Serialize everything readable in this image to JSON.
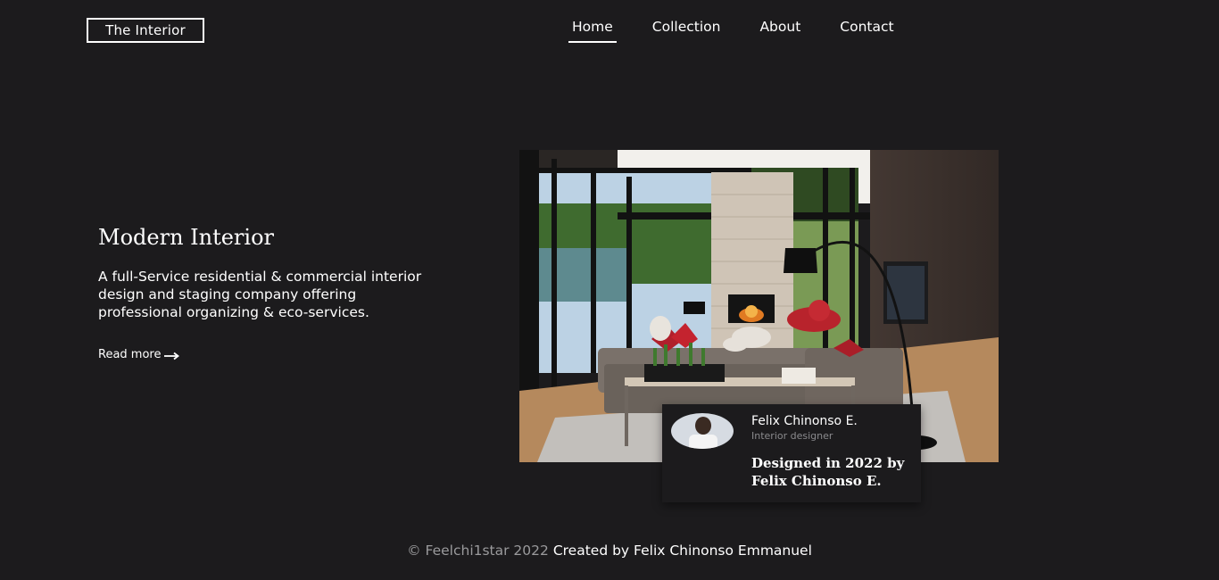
{
  "header": {
    "logo_text": "The Interior",
    "nav": [
      {
        "label": "Home",
        "active": true
      },
      {
        "label": "Collection",
        "active": false
      },
      {
        "label": "About",
        "active": false
      },
      {
        "label": "Contact",
        "active": false
      }
    ]
  },
  "hero": {
    "title": "Modern Interior",
    "description": "A full-Service residential & commercial interior design and staging company offering professional organizing & eco-services.",
    "read_more_label": "Read more",
    "arrow_icon": "arrow-right-icon"
  },
  "designer_card": {
    "name": "Felix Chinonso E.",
    "role": "Interior designer",
    "credit": "Designed in 2022 by Felix Chinonso E."
  },
  "footer": {
    "copyright": "© Feelchi1star 2022",
    "credit": "Created by Felix Chinonso Emmanuel"
  },
  "colors": {
    "background": "#1c1b1d",
    "text": "#ffffff",
    "muted": "#9a9a9c"
  }
}
